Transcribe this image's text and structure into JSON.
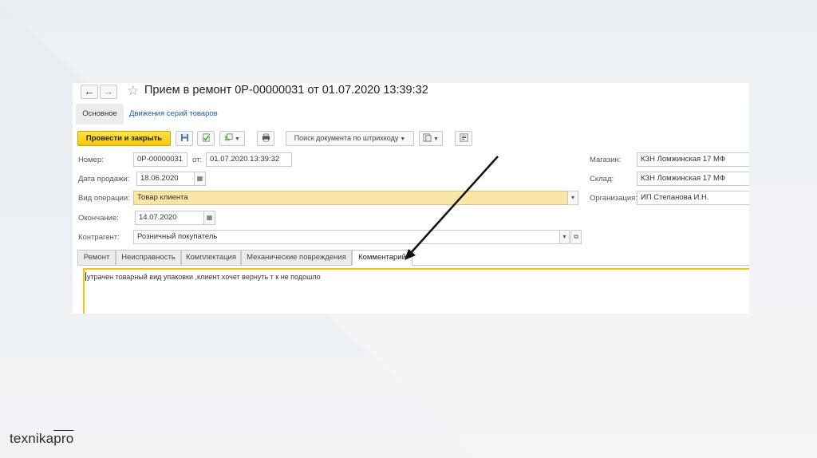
{
  "window": {
    "title": "Прием в ремонт 0Р-00000031 от 01.07.2020 13:39:32",
    "nav_back": "←",
    "nav_forward": "→",
    "star": "☆"
  },
  "subtabs": {
    "main": "Основное",
    "link": "Движения серий товаров"
  },
  "toolbar": {
    "post_close": "Провести и закрыть",
    "search_barcode": "Поиск документа по штрихкоду"
  },
  "form": {
    "number_label": "Номер:",
    "number_value": "0Р-00000031",
    "from_label": "от:",
    "from_value": "01.07.2020 13:39:32",
    "sale_date_label": "Дата продажи:",
    "sale_date_value": "18.06.2020",
    "operation_label": "Вид операции:",
    "operation_value": "Товар клиента",
    "end_label": "Окончание:",
    "end_value": "14.07.2020",
    "counterparty_label": "Контрагент:",
    "counterparty_value": "Розничный покупатель",
    "shop_label": "Магазин:",
    "shop_value": "КЗН Ломжинская 17 МФ",
    "warehouse_label": "Склад:",
    "warehouse_value": "КЗН Ломжинская 17 МФ",
    "org_label": "Организация:",
    "org_value": "ИП Степанова И.Н."
  },
  "tabs": [
    {
      "label": "Ремонт"
    },
    {
      "label": "Неисправность"
    },
    {
      "label": "Комплектация"
    },
    {
      "label": "Механические повреждения"
    },
    {
      "label": "Комментарий"
    }
  ],
  "comment": "утрачен товарный вид упаковки ,клиент хочет вернуть т к не подошло",
  "logo": {
    "main": "texnika",
    "accent": "pro"
  },
  "colors": {
    "primary_button": "#f5c800",
    "highlight_field": "#fbe6a6",
    "link": "#1f5aa8",
    "comment_border": "#f1c40f"
  }
}
